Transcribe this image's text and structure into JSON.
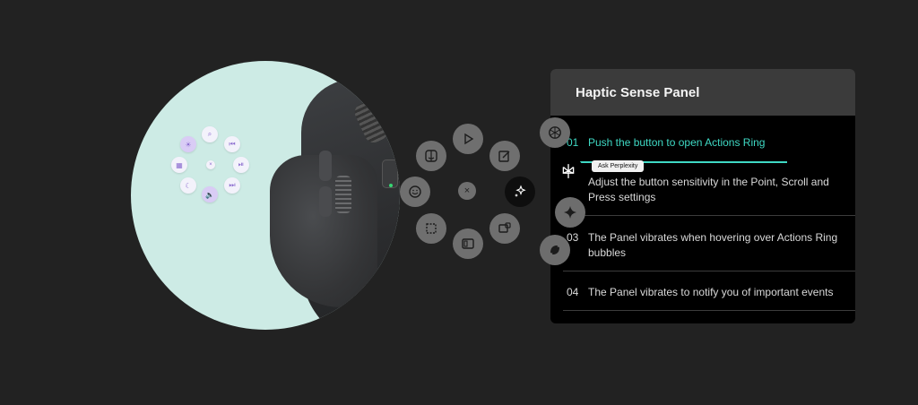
{
  "panel": {
    "title": "Haptic Sense Panel",
    "steps": [
      {
        "num": "01",
        "text": "Push the button to open Actions Ring"
      },
      {
        "num": "",
        "text": "Adjust the button sensitivity in the Point, Scroll and Press settings"
      },
      {
        "num": "03",
        "text": "The Panel vibrates when hovering over Actions Ring bubbles"
      },
      {
        "num": "04",
        "text": "The Panel vibrates to notify you of important events"
      }
    ],
    "active_step": 1
  },
  "tooltip": "Ask Perplexity",
  "ring": {
    "center_label": "×",
    "bubbles": [
      "finder-icon",
      "play-icon",
      "notes-icon",
      "smiley-icon",
      "ai-sparkle-icon",
      "screenshot-icon",
      "split-view-icon",
      "share-screen-icon"
    ]
  },
  "ai_bubbles": [
    "chatgpt-icon",
    "perplexity-icon",
    "gemini-icon",
    "copilot-icon"
  ],
  "colors": {
    "background": "#222222",
    "accent": "#3fd9c4",
    "circle": "#cdebe5",
    "bubble": "#6f6f6f"
  }
}
